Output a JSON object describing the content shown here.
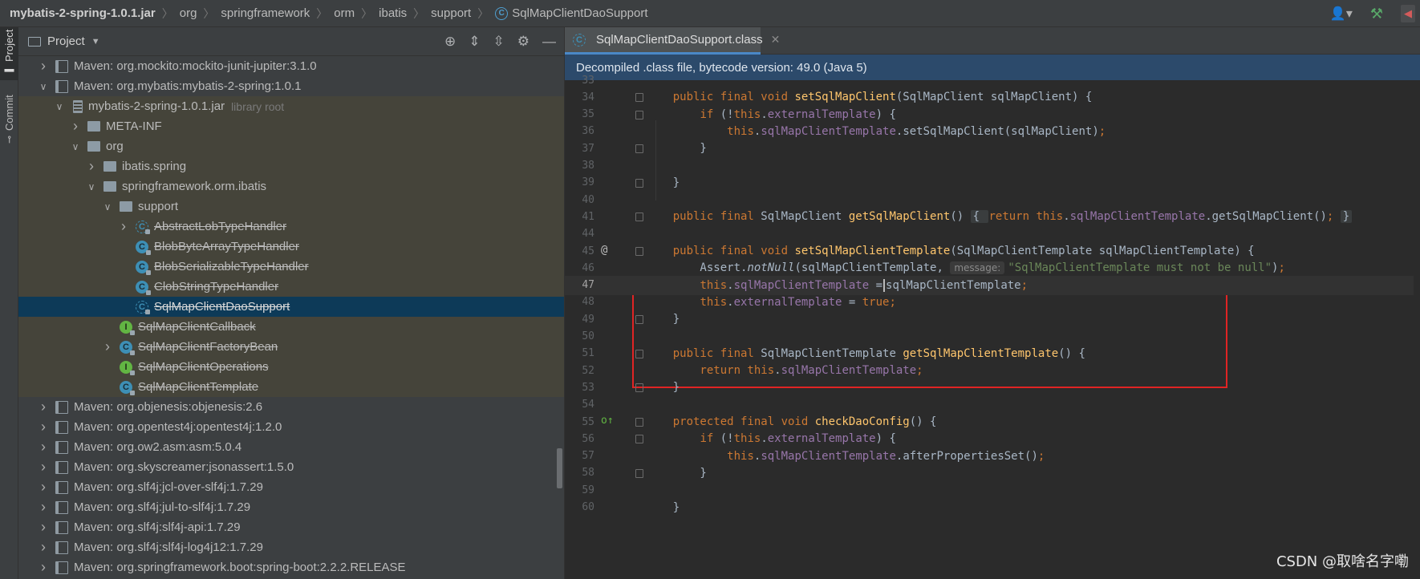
{
  "breadcrumb": [
    {
      "label": "mybatis-2-spring-1.0.1.jar",
      "icon": "none"
    },
    {
      "label": "org",
      "icon": "none"
    },
    {
      "label": "springframework",
      "icon": "none"
    },
    {
      "label": "orm",
      "icon": "none"
    },
    {
      "label": "ibatis",
      "icon": "none"
    },
    {
      "label": "support",
      "icon": "none"
    },
    {
      "label": "SqlMapClientDaoSupport",
      "icon": "class-icon"
    }
  ],
  "toolbar_right": [
    {
      "icon": "user-icon",
      "glyph": "👤▾"
    },
    {
      "icon": "hammer-icon",
      "glyph": "⚒"
    },
    {
      "icon": "run-icon",
      "glyph": "◀"
    }
  ],
  "tool_stripe": {
    "project_tab": "Project",
    "commit_tab": "Commit"
  },
  "project_panel": {
    "title": "Project",
    "tools": [
      {
        "icon": "locate-icon",
        "glyph": "⊕"
      },
      {
        "icon": "expand-all-icon",
        "glyph": "⇕"
      },
      {
        "icon": "collapse-all-icon",
        "glyph": "⇳"
      },
      {
        "icon": "settings-icon",
        "glyph": "⚙"
      },
      {
        "icon": "hide-icon",
        "glyph": "—"
      }
    ],
    "tree": [
      {
        "depth": 1,
        "arrow": "collapsed",
        "icon": "lib",
        "label": "Maven: org.mockito:mockito-junit-jupiter:3.1.0",
        "strike": false,
        "row": "normal"
      },
      {
        "depth": 1,
        "arrow": "expanded",
        "icon": "lib",
        "label": "Maven: org.mybatis:mybatis-2-spring:1.0.1",
        "strike": false,
        "row": "normal"
      },
      {
        "depth": 2,
        "arrow": "expanded",
        "icon": "jar",
        "label": "mybatis-2-spring-1.0.1.jar",
        "sub": "library root",
        "strike": false,
        "row": "lib"
      },
      {
        "depth": 3,
        "arrow": "collapsed",
        "icon": "folder",
        "label": "META-INF",
        "strike": false,
        "row": "lib"
      },
      {
        "depth": 3,
        "arrow": "expanded",
        "icon": "folder",
        "label": "org",
        "strike": false,
        "row": "lib"
      },
      {
        "depth": 4,
        "arrow": "collapsed",
        "icon": "pkg",
        "label": "ibatis.spring",
        "strike": false,
        "row": "lib"
      },
      {
        "depth": 4,
        "arrow": "expanded",
        "icon": "pkg",
        "label": "springframework.orm.ibatis",
        "strike": false,
        "row": "lib"
      },
      {
        "depth": 5,
        "arrow": "expanded",
        "icon": "pkg",
        "label": "support",
        "strike": false,
        "row": "lib"
      },
      {
        "depth": 6,
        "arrow": "collapsed",
        "icon": "abs",
        "label": "AbstractLobTypeHandler",
        "strike": true,
        "row": "lib"
      },
      {
        "depth": 6,
        "arrow": "none",
        "icon": "cls",
        "label": "BlobByteArrayTypeHandler",
        "strike": true,
        "row": "lib"
      },
      {
        "depth": 6,
        "arrow": "none",
        "icon": "cls",
        "label": "BlobSerializableTypeHandler",
        "strike": true,
        "row": "lib"
      },
      {
        "depth": 6,
        "arrow": "none",
        "icon": "cls",
        "label": "ClobStringTypeHandler",
        "strike": true,
        "row": "lib"
      },
      {
        "depth": 6,
        "arrow": "none",
        "icon": "abs",
        "label": "SqlMapClientDaoSupport",
        "strike": true,
        "row": "selected"
      },
      {
        "depth": 5,
        "arrow": "none",
        "icon": "intf",
        "label": "SqlMapClientCallback",
        "strike": true,
        "row": "lib"
      },
      {
        "depth": 5,
        "arrow": "collapsed",
        "icon": "cls",
        "label": "SqlMapClientFactoryBean",
        "strike": true,
        "row": "lib"
      },
      {
        "depth": 5,
        "arrow": "none",
        "icon": "intf",
        "label": "SqlMapClientOperations",
        "strike": true,
        "row": "lib"
      },
      {
        "depth": 5,
        "arrow": "none",
        "icon": "cls",
        "label": "SqlMapClientTemplate",
        "strike": true,
        "row": "lib"
      },
      {
        "depth": 1,
        "arrow": "collapsed",
        "icon": "lib",
        "label": "Maven: org.objenesis:objenesis:2.6",
        "strike": false,
        "row": "normal"
      },
      {
        "depth": 1,
        "arrow": "collapsed",
        "icon": "lib",
        "label": "Maven: org.opentest4j:opentest4j:1.2.0",
        "strike": false,
        "row": "normal"
      },
      {
        "depth": 1,
        "arrow": "collapsed",
        "icon": "lib",
        "label": "Maven: org.ow2.asm:asm:5.0.4",
        "strike": false,
        "row": "normal"
      },
      {
        "depth": 1,
        "arrow": "collapsed",
        "icon": "lib",
        "label": "Maven: org.skyscreamer:jsonassert:1.5.0",
        "strike": false,
        "row": "normal"
      },
      {
        "depth": 1,
        "arrow": "collapsed",
        "icon": "lib",
        "label": "Maven: org.slf4j:jcl-over-slf4j:1.7.29",
        "strike": false,
        "row": "normal"
      },
      {
        "depth": 1,
        "arrow": "collapsed",
        "icon": "lib",
        "label": "Maven: org.slf4j:jul-to-slf4j:1.7.29",
        "strike": false,
        "row": "normal"
      },
      {
        "depth": 1,
        "arrow": "collapsed",
        "icon": "lib",
        "label": "Maven: org.slf4j:slf4j-api:1.7.29",
        "strike": false,
        "row": "normal"
      },
      {
        "depth": 1,
        "arrow": "collapsed",
        "icon": "lib",
        "label": "Maven: org.slf4j:slf4j-log4j12:1.7.29",
        "strike": false,
        "row": "normal"
      },
      {
        "depth": 1,
        "arrow": "collapsed",
        "icon": "lib",
        "label": "Maven: org.springframework.boot:spring-boot:2.2.2.RELEASE",
        "strike": false,
        "row": "normal"
      }
    ]
  },
  "editor": {
    "tab_label": "SqlMapClientDaoSupport.class",
    "info_banner": "Decompiled .class file, bytecode version: 49.0 (Java 5)",
    "caret_line": "47",
    "lines": [
      {
        "num": "33",
        "marker": "",
        "fold": false,
        "tokens": []
      },
      {
        "num": "34",
        "marker": "",
        "fold": true,
        "tokens": [
          [
            "kw",
            "    public final void "
          ],
          [
            "mth",
            "setSqlMapClient"
          ],
          [
            "p",
            "(SqlMapClient sqlMapClient) {"
          ]
        ]
      },
      {
        "num": "35",
        "marker": "",
        "fold": true,
        "tokens": [
          [
            "p",
            "        "
          ],
          [
            "kw",
            "if "
          ],
          [
            "p",
            "(!"
          ],
          [
            "kw",
            "this"
          ],
          [
            "p",
            "."
          ],
          [
            "fld",
            "externalTemplate"
          ],
          [
            "p",
            ") {"
          ]
        ]
      },
      {
        "num": "36",
        "marker": "",
        "fold": false,
        "tokens": [
          [
            "p",
            "            "
          ],
          [
            "kw",
            "this"
          ],
          [
            "p",
            "."
          ],
          [
            "fld",
            "sqlMapClientTemplate"
          ],
          [
            "p",
            ".setSqlMapClient(sqlMapClient)"
          ],
          [
            "kw",
            ";"
          ]
        ]
      },
      {
        "num": "37",
        "marker": "",
        "fold": true,
        "tokens": [
          [
            "p",
            "        }"
          ]
        ]
      },
      {
        "num": "38",
        "marker": "",
        "fold": false,
        "tokens": []
      },
      {
        "num": "39",
        "marker": "",
        "fold": true,
        "tokens": [
          [
            "p",
            "    }"
          ]
        ]
      },
      {
        "num": "40",
        "marker": "",
        "fold": false,
        "tokens": []
      },
      {
        "num": "41",
        "marker": "",
        "fold": true,
        "tokens": [
          [
            "kw",
            "    public final "
          ],
          [
            "p",
            "SqlMapClient "
          ],
          [
            "mth",
            "getSqlMapClient"
          ],
          [
            "p",
            "() "
          ],
          [
            "fb",
            "{ "
          ],
          [
            "kw",
            "return this"
          ],
          [
            "p",
            "."
          ],
          [
            "fld",
            "sqlMapClientTemplate"
          ],
          [
            "p",
            ".getSqlMapClient()"
          ],
          [
            "kw",
            ";"
          ],
          [
            "p",
            " "
          ],
          [
            "fb",
            "}"
          ]
        ]
      },
      {
        "num": "44",
        "marker": "",
        "fold": false,
        "tokens": []
      },
      {
        "num": "45",
        "marker": "@",
        "fold": true,
        "tokens": [
          [
            "kw",
            "    public final void "
          ],
          [
            "mth",
            "setSqlMapClientTemplate"
          ],
          [
            "p",
            "(SqlMapClientTemplate sqlMapClientTemplate) {"
          ]
        ]
      },
      {
        "num": "46",
        "marker": "",
        "fold": false,
        "tokens": [
          [
            "p",
            "        Assert."
          ],
          [
            "it",
            "notNull"
          ],
          [
            "p",
            "(sqlMapClientTemplate, "
          ],
          [
            "hint",
            "message:"
          ],
          [
            "str",
            "\"SqlMapClientTemplate must not be null\""
          ],
          [
            "p",
            ")"
          ],
          [
            "kw",
            ";"
          ]
        ]
      },
      {
        "num": "47",
        "marker": "",
        "fold": false,
        "tokens": [
          [
            "p",
            "        "
          ],
          [
            "kw",
            "this"
          ],
          [
            "p",
            "."
          ],
          [
            "fld",
            "sqlMapClientTemplate"
          ],
          [
            "p",
            " ="
          ],
          [
            "cur",
            ""
          ],
          [
            "p",
            "sqlMapClientTemplate"
          ],
          [
            "kw",
            ";"
          ]
        ]
      },
      {
        "num": "48",
        "marker": "",
        "fold": false,
        "tokens": [
          [
            "p",
            "        "
          ],
          [
            "kw",
            "this"
          ],
          [
            "p",
            "."
          ],
          [
            "fld",
            "externalTemplate"
          ],
          [
            "p",
            " = "
          ],
          [
            "kw",
            "true;"
          ]
        ]
      },
      {
        "num": "49",
        "marker": "",
        "fold": true,
        "tokens": [
          [
            "p",
            "    }"
          ]
        ]
      },
      {
        "num": "50",
        "marker": "",
        "fold": false,
        "tokens": []
      },
      {
        "num": "51",
        "marker": "",
        "fold": true,
        "tokens": [
          [
            "kw",
            "    public final "
          ],
          [
            "p",
            "SqlMapClientTemplate "
          ],
          [
            "mth",
            "getSqlMapClientTemplate"
          ],
          [
            "p",
            "() {"
          ]
        ]
      },
      {
        "num": "52",
        "marker": "",
        "fold": false,
        "tokens": [
          [
            "kw",
            "        return this"
          ],
          [
            "p",
            "."
          ],
          [
            "fld",
            "sqlMapClientTemplate"
          ],
          [
            "kw",
            ";"
          ]
        ]
      },
      {
        "num": "53",
        "marker": "",
        "fold": true,
        "tokens": [
          [
            "p",
            "    }"
          ]
        ]
      },
      {
        "num": "54",
        "marker": "",
        "fold": false,
        "tokens": []
      },
      {
        "num": "55",
        "marker": "o↑",
        "fold": true,
        "tokens": [
          [
            "kw",
            "    protected final void "
          ],
          [
            "mth",
            "checkDaoConfig"
          ],
          [
            "p",
            "() {"
          ]
        ]
      },
      {
        "num": "56",
        "marker": "",
        "fold": true,
        "tokens": [
          [
            "p",
            "        "
          ],
          [
            "kw",
            "if "
          ],
          [
            "p",
            "(!"
          ],
          [
            "kw",
            "this"
          ],
          [
            "p",
            "."
          ],
          [
            "fld",
            "externalTemplate"
          ],
          [
            "p",
            ") {"
          ]
        ]
      },
      {
        "num": "57",
        "marker": "",
        "fold": false,
        "tokens": [
          [
            "p",
            "            "
          ],
          [
            "kw",
            "this"
          ],
          [
            "p",
            "."
          ],
          [
            "fld",
            "sqlMapClientTemplate"
          ],
          [
            "p",
            ".afterPropertiesSet()"
          ],
          [
            "kw",
            ";"
          ]
        ]
      },
      {
        "num": "58",
        "marker": "",
        "fold": true,
        "tokens": [
          [
            "p",
            "        }"
          ]
        ]
      },
      {
        "num": "59",
        "marker": "",
        "fold": false,
        "tokens": []
      },
      {
        "num": "60",
        "marker": "",
        "fold": false,
        "tokens": [
          [
            "p",
            "    }"
          ]
        ]
      }
    ]
  },
  "watermark": "CSDN @取啥名字嘞",
  "colors": {
    "keyword": "#cc7832",
    "field": "#9876aa",
    "method": "#ffc66d",
    "string": "#6a8759",
    "selection": "#0d3a58",
    "library_row": "#45443a",
    "highlight_box": "#e02424"
  }
}
